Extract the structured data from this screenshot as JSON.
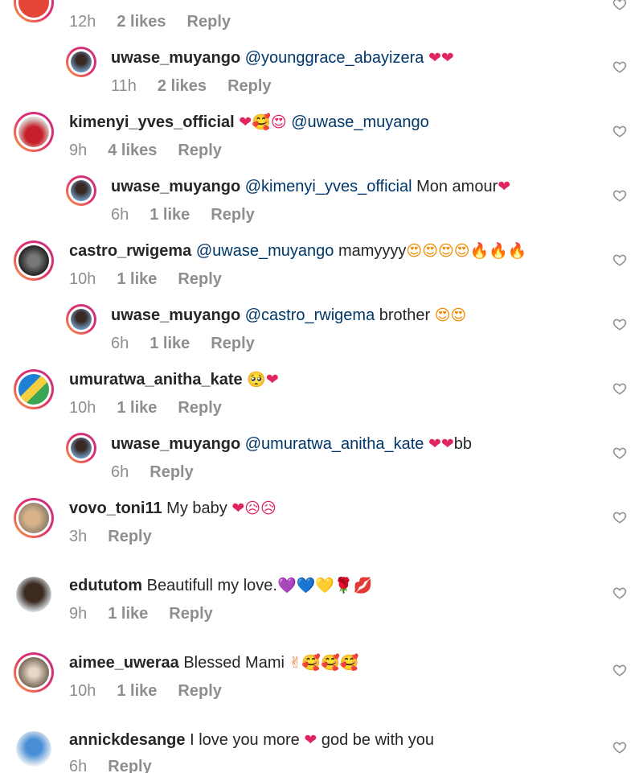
{
  "comments": [
    {
      "time": "12h",
      "likes": "2 likes",
      "reply": "Reply"
    },
    {
      "user": "uwase_muyango",
      "mention": "@younggrace_abayizera",
      "text": "",
      "emoji": "❤❤",
      "time": "11h",
      "likes": "2 likes",
      "reply": "Reply"
    },
    {
      "user": "kimenyi_yves_official",
      "text": "",
      "emoji": "❤🥰😍",
      "mention": "@uwase_muyango",
      "time": "9h",
      "likes": "4 likes",
      "reply": "Reply"
    },
    {
      "user": "uwase_muyango",
      "mention": "@kimenyi_yves_official",
      "text": "Mon amour",
      "emoji": "❤",
      "time": "6h",
      "likes": "1 like",
      "reply": "Reply"
    },
    {
      "user": "castro_rwigema",
      "mention": "@uwase_muyango",
      "text": "mamyyyy",
      "emoji": "😍😍😍😍🔥🔥🔥",
      "time": "10h",
      "likes": "1 like",
      "reply": "Reply"
    },
    {
      "user": "uwase_muyango",
      "mention": "@castro_rwigema",
      "text": "brother",
      "emoji": "😍😍",
      "time": "6h",
      "likes": "1 like",
      "reply": "Reply"
    },
    {
      "user": "umuratwa_anitha_kate",
      "text": "",
      "emoji": "🥺❤",
      "time": "10h",
      "likes": "1 like",
      "reply": "Reply"
    },
    {
      "user": "uwase_muyango",
      "mention": "@umuratwa_anitha_kate",
      "text": "bb",
      "emoji": "❤❤",
      "time": "6h",
      "likes": "",
      "reply": "Reply"
    },
    {
      "user": "vovo_toni11",
      "text": "My baby",
      "emoji": "❤😥😥",
      "time": "3h",
      "likes": "",
      "reply": "Reply"
    },
    {
      "user": "edututom",
      "text": "Beautifull my love.",
      "emoji": "💜💙💛🌹💋",
      "time": "9h",
      "likes": "1 like",
      "reply": "Reply"
    },
    {
      "user": "aimee_uweraa",
      "text": "Blessed Mami",
      "emoji": "✌🥰🥰🥰",
      "time": "10h",
      "likes": "1 like",
      "reply": "Reply"
    },
    {
      "user": "annickdesange",
      "text": "I love you more",
      "emoji": "❤",
      "text2": "god be with you",
      "time": "6h",
      "likes": "",
      "reply": "Reply"
    }
  ],
  "colors": {
    "text": "#262626",
    "meta": "#8e8e8e",
    "mention": "#00376b",
    "heart": "#8e8e8e"
  },
  "icons": {
    "like": "heart-outline-icon"
  }
}
